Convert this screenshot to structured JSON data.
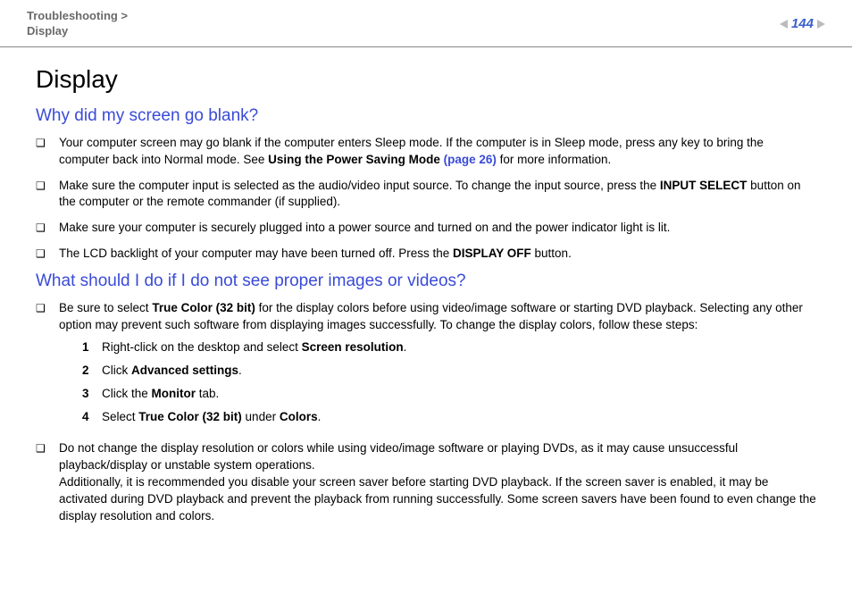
{
  "header": {
    "breadcrumb_line1": "Troubleshooting >",
    "breadcrumb_line2": "Display",
    "page_number": "144"
  },
  "page_title": "Display",
  "section1": {
    "title": "Why did my screen go blank?",
    "items": [
      {
        "pre": "Your computer screen may go blank if the computer enters Sleep mode. If the computer is in Sleep mode, press any key to bring the computer back into Normal mode. See ",
        "bold1": "Using the Power Saving Mode ",
        "link": "(page 26)",
        "post": " for more information."
      },
      {
        "pre": "Make sure the computer input is selected as the audio/video input source. To change the input source, press the ",
        "bold1": "INPUT SELECT",
        "post": " button on the computer or the remote commander (if supplied)."
      },
      {
        "pre": "Make sure your computer is securely plugged into a power source and turned on and the power indicator light is lit."
      },
      {
        "pre": "The LCD backlight of your computer may have been turned off. Press the ",
        "bold1": "DISPLAY OFF",
        "post": " button."
      }
    ]
  },
  "section2": {
    "title": "What should I do if I do not see proper images or videos?",
    "intro_pre": "Be sure to select ",
    "intro_bold": "True Color (32 bit)",
    "intro_post": " for the display colors before using video/image software or starting DVD playback. Selecting any other option may prevent such software from displaying images successfully. To change the display colors, follow these steps:",
    "steps": [
      {
        "pre": "Right-click on the desktop and select ",
        "bold": "Screen resolution",
        "post": "."
      },
      {
        "pre": "Click ",
        "bold": "Advanced settings",
        "post": "."
      },
      {
        "pre": "Click the ",
        "bold": "Monitor",
        "post": " tab."
      },
      {
        "pre": "Select ",
        "bold": "True Color (32 bit)",
        "mid": " under ",
        "bold2": "Colors",
        "post": "."
      }
    ],
    "item2": "Do not change the display resolution or colors while using video/image software or playing DVDs, as it may cause unsuccessful playback/display or unstable system operations.",
    "item2b": "Additionally, it is recommended you disable your screen saver before starting DVD playback. If the screen saver is enabled, it may be activated during DVD playback and prevent the playback from running successfully. Some screen savers have been found to even change the display resolution and colors."
  }
}
